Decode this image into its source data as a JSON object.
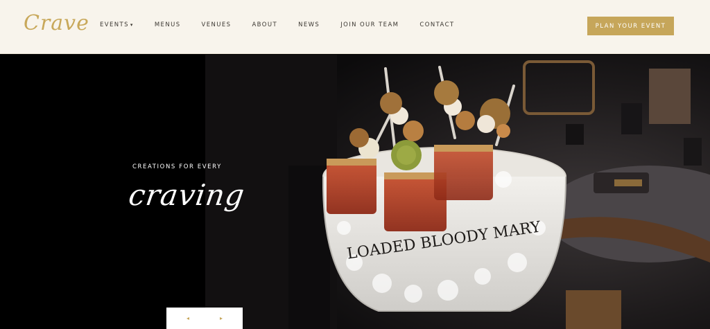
{
  "header": {
    "logo": "Crave",
    "nav": [
      {
        "label": "EVENTS",
        "caret": "▾"
      },
      {
        "label": "MENUS"
      },
      {
        "label": "VENUES"
      },
      {
        "label": "ABOUT"
      },
      {
        "label": "NEWS"
      },
      {
        "label": "JOIN OUR TEAM"
      },
      {
        "label": "CONTACT"
      }
    ],
    "cta": "PLAN YOUR EVENT"
  },
  "hero": {
    "eyebrow": "CREATIONS FOR EVERY",
    "script_title": "craving",
    "bowl_label": "LOADED BLOODY MARY",
    "prev_icon": "◂",
    "next_icon": "▸"
  },
  "colors": {
    "accent": "#c6a65a",
    "header_bg": "#f8f4ec",
    "hero_bg": "#000000"
  }
}
